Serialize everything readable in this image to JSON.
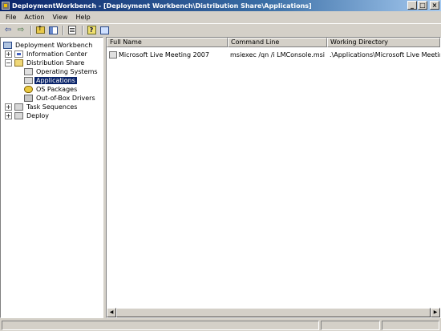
{
  "window": {
    "title": "DeploymentWorkbench - [Deployment Workbench\\Distribution Share\\Applications]",
    "controls": {
      "minimize": "_",
      "maximize": "□",
      "close": "×"
    }
  },
  "menu": {
    "items": [
      {
        "label": "File"
      },
      {
        "label": "Action"
      },
      {
        "label": "View"
      },
      {
        "label": "Help"
      }
    ]
  },
  "toolbar": {
    "buttons": [
      "back-arrow-icon",
      "forward-arrow-icon",
      "folder-up-icon",
      "show-hide-tree-icon",
      "properties-icon",
      "help-icon",
      "console-icon"
    ]
  },
  "tree": {
    "root": {
      "label": "Deployment Workbench"
    },
    "items": [
      {
        "label": "Information Center",
        "expander": "+"
      },
      {
        "label": "Distribution Share",
        "expander": "−"
      },
      {
        "label": "Operating Systems"
      },
      {
        "label": "Applications",
        "selected": true
      },
      {
        "label": "OS Packages"
      },
      {
        "label": "Out-of-Box Drivers"
      },
      {
        "label": "Task Sequences",
        "expander": "+"
      },
      {
        "label": "Deploy",
        "expander": "+"
      }
    ]
  },
  "list": {
    "columns": [
      "Full Name",
      "Command Line",
      "Working Directory"
    ],
    "rows": [
      {
        "full_name": "Microsoft Live Meeting 2007",
        "command_line": "msiexec /qn /i LMConsole.msi",
        "working_directory": ".\\Applications\\Microsoft Live Meeting..."
      }
    ]
  },
  "scrollbar": {
    "left": "◀",
    "right": "▶"
  }
}
